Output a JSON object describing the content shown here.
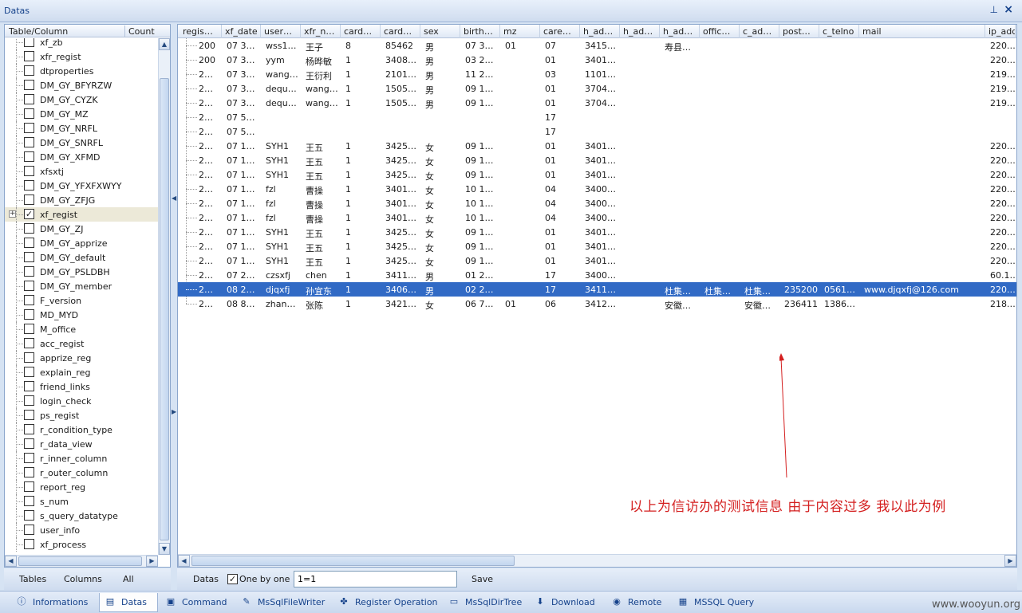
{
  "window": {
    "title": "Datas",
    "pin_icon": "pin-icon",
    "close_icon": "close-icon"
  },
  "left_panel": {
    "col_table": "Table/Column",
    "col_count": "Count",
    "items": [
      {
        "label": "xf_zb",
        "checked": false
      },
      {
        "label": "xfr_regist",
        "checked": false
      },
      {
        "label": "dtproperties",
        "checked": false
      },
      {
        "label": "DM_GY_BFYRZW",
        "checked": false
      },
      {
        "label": "DM_GY_CYZK",
        "checked": false
      },
      {
        "label": "DM_GY_MZ",
        "checked": false
      },
      {
        "label": "DM_GY_NRFL",
        "checked": false
      },
      {
        "label": "DM_GY_SNRFL",
        "checked": false
      },
      {
        "label": "DM_GY_XFMD",
        "checked": false
      },
      {
        "label": "xfsxtj",
        "checked": false
      },
      {
        "label": "DM_GY_YFXFXWYY",
        "checked": false
      },
      {
        "label": "DM_GY_ZFJG",
        "checked": false
      },
      {
        "label": "xf_regist",
        "checked": true,
        "expandable": true,
        "selected": true
      },
      {
        "label": "DM_GY_ZJ",
        "checked": false
      },
      {
        "label": "DM_GY_apprize",
        "checked": false
      },
      {
        "label": "DM_GY_default",
        "checked": false
      },
      {
        "label": "DM_GY_PSLDBH",
        "checked": false
      },
      {
        "label": "DM_GY_member",
        "checked": false
      },
      {
        "label": "F_version",
        "checked": false
      },
      {
        "label": "MD_MYD",
        "checked": false
      },
      {
        "label": "M_office",
        "checked": false
      },
      {
        "label": "acc_regist",
        "checked": false
      },
      {
        "label": "apprize_reg",
        "checked": false
      },
      {
        "label": "explain_reg",
        "checked": false
      },
      {
        "label": "friend_links",
        "checked": false
      },
      {
        "label": "login_check",
        "checked": false
      },
      {
        "label": "ps_regist",
        "checked": false
      },
      {
        "label": "r_condition_type",
        "checked": false
      },
      {
        "label": "r_data_view",
        "checked": false
      },
      {
        "label": "r_inner_column",
        "checked": false
      },
      {
        "label": "r_outer_column",
        "checked": false
      },
      {
        "label": "report_reg",
        "checked": false
      },
      {
        "label": "s_num",
        "checked": false
      },
      {
        "label": "s_query_datatype",
        "checked": false
      },
      {
        "label": "user_info",
        "checked": false
      },
      {
        "label": "xf_process",
        "checked": false
      }
    ],
    "bottom": {
      "tables": "Tables",
      "columns": "Columns",
      "all": "All"
    }
  },
  "grid": {
    "columns": [
      "regis…",
      "xf_date",
      "user…",
      "xfr_n…",
      "card…",
      "card…",
      "sex",
      "birth…",
      "mz",
      "care…",
      "h_ad…",
      "h_ad…",
      "h_ad…",
      "offic…",
      "c_ad…",
      "post…",
      "c_telno",
      "mail",
      "ip_add"
    ],
    "rows": [
      {
        "cells": [
          "200",
          "07 3…",
          "wss1…",
          "王子",
          "8",
          "85462",
          "男",
          "07 3…",
          "01",
          "07",
          "3415…",
          "",
          "寿县…",
          "",
          "",
          "",
          "",
          "",
          "220.…"
        ]
      },
      {
        "cells": [
          "200",
          "07 3…",
          "yym",
          "杨晔敏",
          "1",
          "3408…",
          "男",
          "03 2…",
          "",
          "01",
          "3401…",
          "",
          "",
          "",
          "",
          "",
          "",
          "",
          "220.…"
        ]
      },
      {
        "cells": [
          "2…",
          "07 3…",
          "wang…",
          "王衍利",
          "1",
          "2101…",
          "男",
          "11 2…",
          "",
          "03",
          "1101…",
          "",
          "",
          "",
          "",
          "",
          "",
          "",
          "219.…"
        ]
      },
      {
        "cells": [
          "2…",
          "07 3…",
          "dequ…",
          "wang…",
          "1",
          "1505…",
          "男",
          "09 1…",
          "",
          "01",
          "3704…",
          "",
          "",
          "",
          "",
          "",
          "",
          "",
          "219.…"
        ]
      },
      {
        "cells": [
          "2…",
          "07 3…",
          "dequ…",
          "wang…",
          "1",
          "1505…",
          "男",
          "09 1…",
          "",
          "01",
          "3704…",
          "",
          "",
          "",
          "",
          "",
          "",
          "",
          "219.…"
        ]
      },
      {
        "cells": [
          "2…",
          "07 5…",
          "",
          "",
          "",
          "",
          "",
          "",
          "",
          "17",
          "",
          "",
          "",
          "",
          "",
          "",
          "",
          "",
          ""
        ]
      },
      {
        "cells": [
          "2…",
          "07 5…",
          "",
          "",
          "",
          "",
          "",
          "",
          "",
          "17",
          "",
          "",
          "",
          "",
          "",
          "",
          "",
          "",
          ""
        ]
      },
      {
        "cells": [
          "2…",
          "07 1…",
          "SYH1",
          "王五",
          "1",
          "3425…",
          "女",
          "09 1…",
          "",
          "01",
          "3401…",
          "",
          "",
          "",
          "",
          "",
          "",
          "",
          "220.…"
        ]
      },
      {
        "cells": [
          "2…",
          "07 1…",
          "SYH1",
          "王五",
          "1",
          "3425…",
          "女",
          "09 1…",
          "",
          "01",
          "3401…",
          "",
          "",
          "",
          "",
          "",
          "",
          "",
          "220.…"
        ]
      },
      {
        "cells": [
          "2…",
          "07 1…",
          "SYH1",
          "王五",
          "1",
          "3425…",
          "女",
          "09 1…",
          "",
          "01",
          "3401…",
          "",
          "",
          "",
          "",
          "",
          "",
          "",
          "220.…"
        ]
      },
      {
        "cells": [
          "2…",
          "07 1…",
          "fzl",
          "曹操",
          "1",
          "3401…",
          "女",
          "10 1…",
          "",
          "04",
          "3400…",
          "",
          "",
          "",
          "",
          "",
          "",
          "",
          "220.…"
        ]
      },
      {
        "cells": [
          "2…",
          "07 1…",
          "fzl",
          "曹操",
          "1",
          "3401…",
          "女",
          "10 1…",
          "",
          "04",
          "3400…",
          "",
          "",
          "",
          "",
          "",
          "",
          "",
          "220.…"
        ]
      },
      {
        "cells": [
          "2…",
          "07 1…",
          "fzl",
          "曹操",
          "1",
          "3401…",
          "女",
          "10 1…",
          "",
          "04",
          "3400…",
          "",
          "",
          "",
          "",
          "",
          "",
          "",
          "220.…"
        ]
      },
      {
        "cells": [
          "2…",
          "07 1…",
          "SYH1",
          "王五",
          "1",
          "3425…",
          "女",
          "09 1…",
          "",
          "01",
          "3401…",
          "",
          "",
          "",
          "",
          "",
          "",
          "",
          "220.…"
        ]
      },
      {
        "cells": [
          "2…",
          "07 1…",
          "SYH1",
          "王五",
          "1",
          "3425…",
          "女",
          "09 1…",
          "",
          "01",
          "3401…",
          "",
          "",
          "",
          "",
          "",
          "",
          "",
          "220.…"
        ]
      },
      {
        "cells": [
          "2…",
          "07 1…",
          "SYH1",
          "王五",
          "1",
          "3425…",
          "女",
          "09 1…",
          "",
          "01",
          "3401…",
          "",
          "",
          "",
          "",
          "",
          "",
          "",
          "220.…"
        ]
      },
      {
        "cells": [
          "2…",
          "07 2…",
          "czsxfj",
          "chen",
          "1",
          "3411…",
          "男",
          "01 2…",
          "",
          "17",
          "3400…",
          "",
          "",
          "",
          "",
          "",
          "",
          "",
          "60.1…"
        ]
      },
      {
        "cells": [
          "2…",
          "08 2…",
          "djqxfj",
          "孙宜东",
          "1",
          "3406…",
          "男",
          "02 2…",
          "",
          "17",
          "3411…",
          "",
          "杜集…",
          "杜集…",
          "杜集…",
          "235200",
          "0561…",
          "www.djqxfj@126.com",
          "220.…"
        ],
        "selected": true
      },
      {
        "cells": [
          "2…",
          "08 8…",
          "zhan…",
          "张陈",
          "1",
          "3421…",
          "女",
          "06 7…",
          "01",
          "06",
          "3412…",
          "",
          "安徽…",
          "",
          "安徽…",
          "236411",
          "1386…",
          "",
          "218.…"
        ]
      }
    ],
    "annotation": "以上为信访办的测试信息   由于内容过多   我以此为例",
    "annotation_color": "#d42020",
    "selection_color": "#316ac5"
  },
  "options_bar": {
    "datas": "Datas",
    "one_by_one": "One by one",
    "one_by_one_checked": true,
    "query_value": "1=1",
    "save": "Save"
  },
  "tabs": [
    {
      "label": "Informations",
      "icon": "info-icon"
    },
    {
      "label": "Datas",
      "icon": "database-icon",
      "active": true
    },
    {
      "label": "Command",
      "icon": "console-icon"
    },
    {
      "label": "MsSqlFileWriter",
      "icon": "pen-icon"
    },
    {
      "label": "Register Operation",
      "icon": "registry-icon"
    },
    {
      "label": "MsSqlDirTree",
      "icon": "folder-icon"
    },
    {
      "label": "Download",
      "icon": "download-icon"
    },
    {
      "label": "Remote",
      "icon": "globe-icon"
    },
    {
      "label": "MSSQL Query",
      "icon": "sql-icon"
    }
  ],
  "watermark": "www.wooyun.org"
}
